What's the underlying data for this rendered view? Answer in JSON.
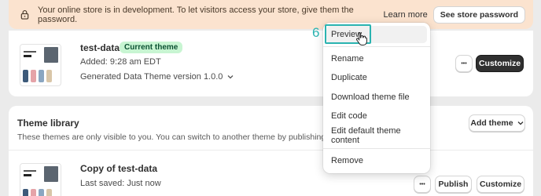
{
  "banner": {
    "message": "Your online store is in development. To let visitors access your store, give them the password.",
    "learn_more": "Learn more",
    "password_button": "See store password"
  },
  "current_theme": {
    "name": "test-data",
    "badge": "Current theme",
    "added": "Added: 9:28 am EDT",
    "version": "Generated Data Theme version 1.0.0",
    "customize": "Customize",
    "more": "•••"
  },
  "library": {
    "title": "Theme library",
    "description": "These themes are only visible to you. You can switch to another theme by publishing it to",
    "add_theme": "Add theme",
    "theme_name": "Copy of test-data",
    "saved": "Last saved: Just now",
    "publish": "Publish",
    "customize": "Customize",
    "more": "•••"
  },
  "menu": {
    "items": [
      "Preview",
      "Rename",
      "Duplicate",
      "Download theme file",
      "Edit code",
      "Edit default theme content",
      "Remove"
    ]
  },
  "annotation": {
    "step": "6",
    "color": "#2ab3b0"
  },
  "colors": {
    "banner_bg": "#fbe3cf",
    "badge_bg": "#c8f5d2",
    "primary_btn": "#303030"
  }
}
